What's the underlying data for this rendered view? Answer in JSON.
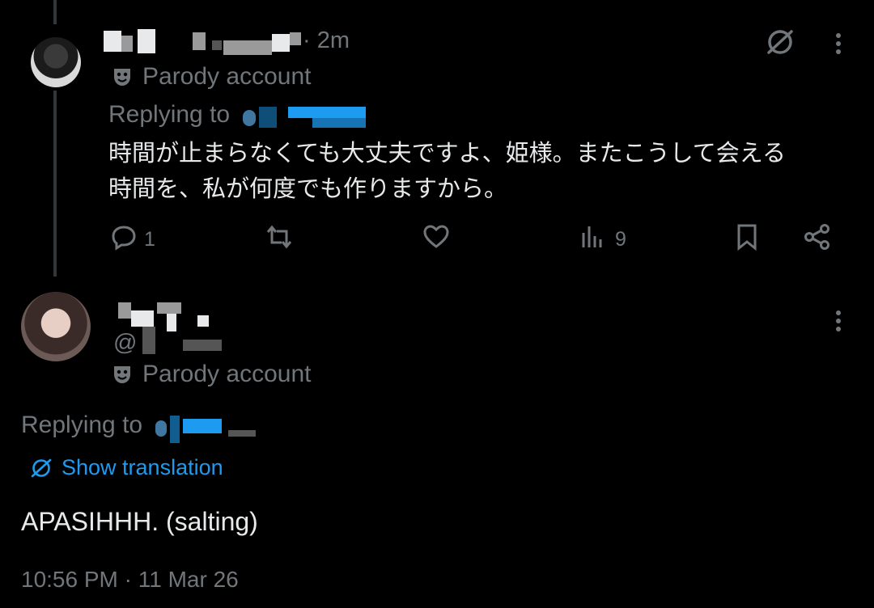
{
  "tweet1": {
    "time_label": "· 2m",
    "parody_label": "Parody account",
    "replying_to_label": "Replying to",
    "text_line1": "時間が止まらなくても大丈夫ですよ、姫様。またこうして会える",
    "text_line2": "時間を、私が何度でも作りますから。",
    "reply_count": "1",
    "views_count": "9",
    "icons": [
      "translate-icon",
      "more-icon",
      "reply-icon",
      "retweet-icon",
      "like-icon",
      "views-icon",
      "bookmark-icon",
      "share-icon"
    ]
  },
  "tweet2": {
    "handle_prefix": "@",
    "parody_label": "Parody account",
    "replying_to_label": "Replying to",
    "show_translation_label": "Show translation",
    "text": "APASIHHH. (salting)",
    "timestamp": "10:56 PM · 11 Mar 26"
  },
  "colors": {
    "background": "#000000",
    "text": "#e7e9ea",
    "muted": "#71767b",
    "accent": "#1d9bf0"
  }
}
